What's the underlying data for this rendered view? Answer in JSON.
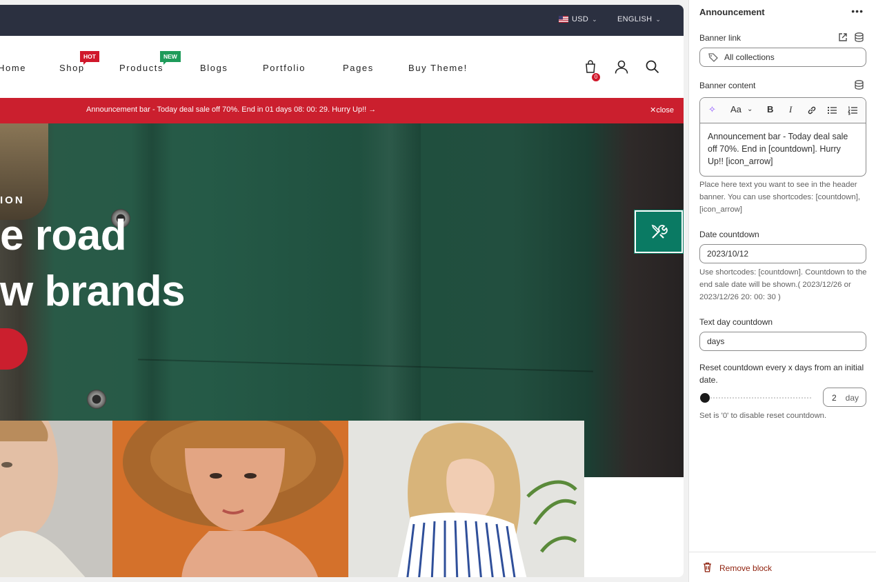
{
  "topbar": {
    "currency": "USD",
    "language": "ENGLISH"
  },
  "nav": {
    "items": [
      {
        "label": "Home"
      },
      {
        "label": "Shop",
        "badge": "HOT"
      },
      {
        "label": "Products",
        "badge": "NEW"
      },
      {
        "label": "Blogs"
      },
      {
        "label": "Portfolio"
      },
      {
        "label": "Pages"
      },
      {
        "label": "Buy Theme!"
      }
    ],
    "cart_count": "0"
  },
  "announcement": {
    "text": "Announcement bar - Today deal sale off 70%. End in 01 days 08: 00: 29. Hurry Up!! →",
    "close_label": "close"
  },
  "hero": {
    "kicker": "ION",
    "title_line1": "e road",
    "title_line2": "w brands"
  },
  "panel": {
    "title": "Announcement",
    "banner_link": {
      "label": "Banner link",
      "value": "All collections"
    },
    "banner_content": {
      "label": "Banner content",
      "text": "Announcement bar - Today deal sale off 70%. End in [countdown]. Hurry Up!! [icon_arrow]",
      "help": "Place here text you want to see in the header banner. You can use shortcodes: [countdown], [icon_arrow]"
    },
    "date_countdown": {
      "label": "Date countdown",
      "value": "2023/10/12",
      "help": "Use shortcodes: [countdown]. Countdown to the end sale date will be shown.( 2023/12/26 or 2023/12/26 20: 00: 30 )"
    },
    "text_day_countdown": {
      "label": "Text day countdown",
      "value": "days"
    },
    "reset_countdown": {
      "label": "Reset countdown every x days from an initial date.",
      "value": "2",
      "unit": "day",
      "slider_fraction": 0.0,
      "help": "Set is '0' to disable reset countdown."
    },
    "remove_label": "Remove block"
  },
  "colors": {
    "announce_bar": "#cb1f2e",
    "topbar": "#2b3040",
    "tools_button": "#0a7a63",
    "remove_text": "#8e1f0b"
  }
}
